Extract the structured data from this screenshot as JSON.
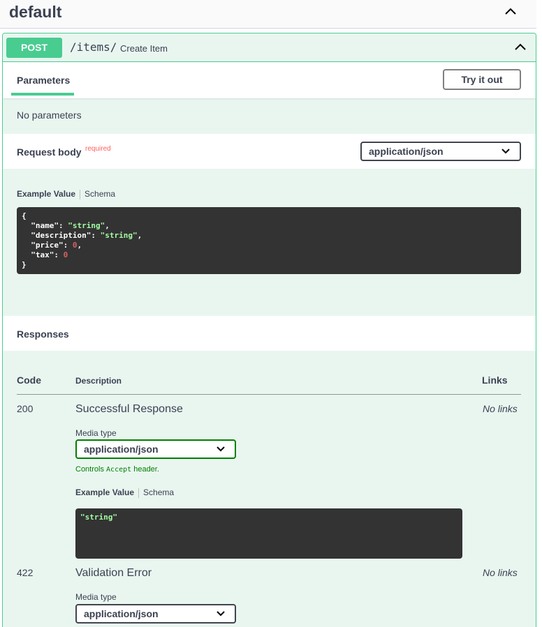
{
  "tag": {
    "title": "default"
  },
  "operation": {
    "method": "POST",
    "path": "/items/",
    "summary": "Create Item",
    "tab_parameters": "Parameters",
    "try_button": "Try it out",
    "no_parameters": "No parameters",
    "request_body": {
      "title": "Request body",
      "required": "required",
      "content_type": "application/json",
      "tab_example": "Example Value",
      "tab_schema": "Schema",
      "example_lines": [
        {
          "open": "{"
        },
        {
          "key": "\"name\"",
          "val": "\"string\"",
          "kind": "s",
          "comma": ","
        },
        {
          "key": "\"description\"",
          "val": "\"string\"",
          "kind": "s",
          "comma": ","
        },
        {
          "key": "\"price\"",
          "val": "0",
          "kind": "n",
          "comma": ","
        },
        {
          "key": "\"tax\"",
          "val": "0",
          "kind": "n",
          "comma": ""
        },
        {
          "close": "}"
        }
      ]
    },
    "responses": {
      "title": "Responses",
      "col_code": "Code",
      "col_description": "Description",
      "col_links": "Links",
      "items": [
        {
          "code": "200",
          "description": "Successful Response",
          "links": "No links",
          "media_label": "Media type",
          "media_type": "application/json",
          "controls_prefix": "Controls ",
          "controls_code": "Accept",
          "controls_suffix": " header.",
          "tab_example": "Example Value",
          "tab_schema": "Schema",
          "example": "\"string\""
        },
        {
          "code": "422",
          "description": "Validation Error",
          "links": "No links",
          "media_label": "Media type",
          "media_type": "application/json"
        }
      ]
    }
  },
  "colors": {
    "post": "#49cc90",
    "post_bg": "#e9f6f0",
    "required": "#ff6060",
    "controls": "#008000"
  }
}
